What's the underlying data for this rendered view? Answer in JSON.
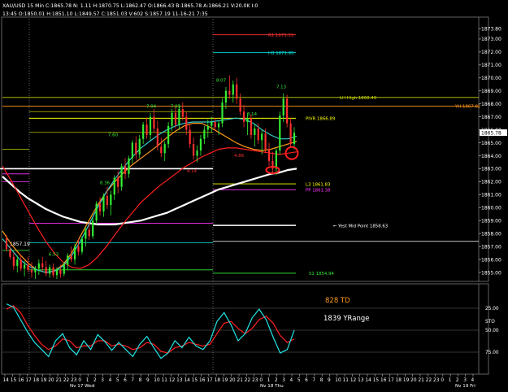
{
  "header": {
    "row1": "XAU/USD 15 Min C:1865.78  N:  1.11  H:1870.75  L:1862.47  O:1866.43  B:1865.78  A:1866.21  V:20.0K  I:0",
    "row2": "13:45  O:1850.01  H:1851.10  L:1849.57  C:1851.03  V:602  S:1857.19  11-16-21  7:35"
  },
  "chart_data": {
    "type": "line",
    "title": "XAU/USD 15 Min",
    "instrument": "XAU/USD",
    "timeframe": "15 Min",
    "quote": {
      "C": 1865.78,
      "N": 1.11,
      "H": 1870.75,
      "L": 1862.47,
      "O": 1866.43,
      "B": 1865.78,
      "A": 1866.21,
      "V": "20.0K",
      "I": 0
    },
    "cursor_bar": {
      "time": "13:45",
      "O": 1850.01,
      "H": 1851.1,
      "L": 1849.57,
      "C": 1851.03,
      "V": 602,
      "S": 1857.19,
      "date": "11-16-21",
      "clock": "7:35"
    },
    "price_ylim": [
      1854.5,
      1874.5
    ],
    "price_ticks": [
      1873.8,
      1873.0,
      1872.0,
      1871.0,
      1870.0,
      1869.0,
      1868.0,
      1867.0,
      1866.0,
      1865.0,
      1864.0,
      1863.0,
      1862.0,
      1861.0,
      1860.0,
      1859.0,
      1858.0,
      1857.0,
      1856.0,
      1855.0
    ],
    "tick_labels": [
      "1873.80",
      "1873.00",
      "1872.00",
      "1871.00",
      "1870.00",
      "1869.00",
      "1868.00",
      "1867.00",
      "1866.00",
      "1865.00",
      "1864.00",
      "1863.00",
      "1862.00",
      "1861.00",
      "1860.00",
      "1859.00",
      "1858.00",
      "1857.00",
      "1856.00",
      "1855.00"
    ],
    "last_price_label": "1865.78",
    "x_labels": [
      "14",
      "15",
      "16",
      "17",
      "18",
      "19",
      "20",
      "21",
      "22",
      "23",
      "0",
      "1",
      "2",
      "3",
      "4",
      "5",
      "6",
      "7",
      "8",
      "9",
      "10",
      "11",
      "12",
      "13",
      "14",
      "15",
      "16",
      "17",
      "18",
      "19",
      "20",
      "21",
      "22",
      "23",
      "0",
      "1",
      "2",
      "3",
      "4",
      "5",
      "6",
      "7",
      "8",
      "9",
      "10",
      "11",
      "12",
      "13",
      "14",
      "15",
      "16",
      "17",
      "18",
      "19",
      "20",
      "21",
      "22",
      "23",
      "0",
      "1",
      "2",
      "3",
      "4"
    ],
    "date_labels": [
      "Nv 17 Wed",
      "Nv 18 Thu",
      "Nv 19 Fri"
    ],
    "candles": [
      [
        1857.6,
        1857.9,
        1856.6,
        1856.8
      ],
      [
        1856.8,
        1857.0,
        1856.0,
        1856.2
      ],
      [
        1856.2,
        1856.5,
        1855.2,
        1855.5
      ],
      [
        1855.5,
        1856.3,
        1855.0,
        1856.0
      ],
      [
        1856.0,
        1856.4,
        1855.1,
        1855.3
      ],
      [
        1855.3,
        1855.9,
        1854.7,
        1855.6
      ],
      [
        1855.6,
        1856.2,
        1855.0,
        1855.2
      ],
      [
        1855.2,
        1855.8,
        1854.6,
        1855.0
      ],
      [
        1855.0,
        1855.5,
        1854.5,
        1855.3
      ],
      [
        1855.3,
        1856.0,
        1854.8,
        1855.7
      ],
      [
        1855.7,
        1856.2,
        1855.1,
        1855.4
      ],
      [
        1855.4,
        1855.9,
        1854.7,
        1854.9
      ],
      [
        1854.9,
        1855.6,
        1854.6,
        1855.4
      ],
      [
        1855.4,
        1855.7,
        1854.6,
        1854.8
      ],
      [
        1854.8,
        1855.4,
        1854.5,
        1855.2
      ],
      [
        1855.2,
        1855.6,
        1854.6,
        1854.9
      ],
      [
        1854.9,
        1855.8,
        1854.7,
        1855.6
      ],
      [
        1855.6,
        1856.5,
        1855.2,
        1856.3
      ],
      [
        1856.3,
        1857.0,
        1855.8,
        1856.0
      ],
      [
        1856.0,
        1857.2,
        1855.6,
        1857.0
      ],
      [
        1857.0,
        1857.6,
        1856.3,
        1856.6
      ],
      [
        1856.6,
        1857.8,
        1856.4,
        1857.6
      ],
      [
        1857.6,
        1858.5,
        1857.0,
        1858.3
      ],
      [
        1858.3,
        1858.9,
        1857.5,
        1857.8
      ],
      [
        1857.8,
        1859.2,
        1857.6,
        1859.0
      ],
      [
        1859.0,
        1860.5,
        1858.7,
        1860.3
      ],
      [
        1860.3,
        1860.8,
        1859.4,
        1859.7
      ],
      [
        1859.7,
        1861.1,
        1859.3,
        1860.9
      ],
      [
        1860.9,
        1861.6,
        1859.9,
        1860.2
      ],
      [
        1860.2,
        1861.3,
        1859.4,
        1861.0
      ],
      [
        1861.0,
        1862.5,
        1860.6,
        1862.3
      ],
      [
        1862.3,
        1862.8,
        1861.1,
        1861.6
      ],
      [
        1861.6,
        1863.4,
        1861.3,
        1863.2
      ],
      [
        1863.2,
        1863.8,
        1862.2,
        1862.6
      ],
      [
        1862.6,
        1864.0,
        1862.3,
        1863.8
      ],
      [
        1863.8,
        1865.2,
        1863.4,
        1865.0
      ],
      [
        1865.0,
        1865.5,
        1863.7,
        1864.1
      ],
      [
        1864.1,
        1865.6,
        1863.8,
        1865.3
      ],
      [
        1865.3,
        1866.6,
        1864.9,
        1866.4
      ],
      [
        1866.4,
        1866.9,
        1865.3,
        1865.6
      ],
      [
        1865.6,
        1867.3,
        1865.2,
        1867.0
      ],
      [
        1867.0,
        1867.6,
        1865.8,
        1866.1
      ],
      [
        1866.1,
        1866.7,
        1864.4,
        1864.7
      ],
      [
        1864.7,
        1865.4,
        1863.9,
        1864.2
      ],
      [
        1864.2,
        1865.1,
        1863.6,
        1864.9
      ],
      [
        1864.9,
        1866.6,
        1864.6,
        1866.3
      ],
      [
        1866.3,
        1867.6,
        1865.9,
        1867.3
      ],
      [
        1867.3,
        1867.8,
        1866.1,
        1866.4
      ],
      [
        1866.4,
        1867.9,
        1866.0,
        1867.6
      ],
      [
        1867.6,
        1868.1,
        1866.7,
        1867.0
      ],
      [
        1867.0,
        1867.4,
        1865.6,
        1866.0
      ],
      [
        1866.0,
        1866.5,
        1864.6,
        1864.9
      ],
      [
        1864.9,
        1865.4,
        1863.7,
        1864.0
      ],
      [
        1864.0,
        1864.8,
        1863.5,
        1864.4
      ],
      [
        1864.4,
        1865.6,
        1864.0,
        1865.3
      ],
      [
        1865.3,
        1866.3,
        1864.9,
        1866.0
      ],
      [
        1866.0,
        1866.8,
        1865.4,
        1866.3
      ],
      [
        1866.3,
        1867.0,
        1865.8,
        1866.6
      ],
      [
        1866.6,
        1866.9,
        1865.9,
        1866.2
      ],
      [
        1866.2,
        1866.7,
        1865.6,
        1866.5
      ],
      [
        1866.5,
        1868.4,
        1866.2,
        1868.1
      ],
      [
        1868.1,
        1869.3,
        1867.6,
        1869.0
      ],
      [
        1869.0,
        1870.2,
        1868.4,
        1868.7
      ],
      [
        1868.7,
        1869.8,
        1868.1,
        1869.5
      ],
      [
        1869.5,
        1870.0,
        1868.0,
        1868.4
      ],
      [
        1868.4,
        1868.8,
        1867.1,
        1867.4
      ],
      [
        1867.4,
        1867.9,
        1866.2,
        1866.6
      ],
      [
        1866.6,
        1867.3,
        1865.6,
        1866.9
      ],
      [
        1866.9,
        1867.2,
        1865.3,
        1865.6
      ],
      [
        1865.6,
        1866.4,
        1864.7,
        1866.1
      ],
      [
        1866.1,
        1866.5,
        1864.9,
        1865.2
      ],
      [
        1865.2,
        1866.0,
        1864.1,
        1865.7
      ],
      [
        1865.7,
        1866.1,
        1864.2,
        1864.5
      ],
      [
        1864.5,
        1865.0,
        1863.2,
        1863.6
      ],
      [
        1863.6,
        1864.3,
        1862.7,
        1863.0
      ],
      [
        1863.0,
        1864.6,
        1862.5,
        1864.4
      ],
      [
        1864.4,
        1867.4,
        1864.1,
        1867.1
      ],
      [
        1867.1,
        1868.8,
        1866.6,
        1868.4
      ],
      [
        1868.4,
        1868.7,
        1866.2,
        1866.5
      ],
      [
        1866.5,
        1866.9,
        1864.6,
        1864.9
      ],
      [
        1864.9,
        1866.2,
        1864.5,
        1865.78
      ]
    ],
    "moving_averages": [
      {
        "name": "white",
        "color": "#ffffff",
        "values": [
          1862.4,
          1861.8,
          1861.2,
          1860.7,
          1860.3,
          1859.9,
          1859.6,
          1859.3,
          1859.1,
          1858.9,
          1858.8,
          1858.7,
          1858.7,
          1858.7,
          1858.8,
          1858.9,
          1859.0,
          1859.2,
          1859.4,
          1859.6,
          1859.9,
          1860.2,
          1860.5,
          1860.8,
          1861.1,
          1861.4,
          1861.6,
          1861.8,
          1862.0,
          1862.2,
          1862.4,
          1862.6,
          1862.7,
          1862.9,
          1863.0
        ]
      },
      {
        "name": "red",
        "color": "#ff2020",
        "values": [
          1863.2,
          1862.1,
          1860.9,
          1859.7,
          1858.5,
          1857.4,
          1856.5,
          1855.8,
          1855.4,
          1855.3,
          1855.6,
          1856.2,
          1857.0,
          1857.9,
          1858.8,
          1859.6,
          1860.4,
          1861.0,
          1861.6,
          1862.1,
          1862.6,
          1863.1,
          1863.5,
          1863.9,
          1864.2,
          1864.5,
          1864.6,
          1864.6,
          1864.5,
          1864.4,
          1864.3,
          1864.2,
          1864.1,
          1864.2,
          1864.3
        ]
      },
      {
        "name": "orange",
        "color": "#ff9a1a",
        "values": [
          1858.2,
          1857.2,
          1856.4,
          1855.7,
          1855.2,
          1855.0,
          1855.1,
          1855.6,
          1856.5,
          1857.8,
          1859.0,
          1860.2,
          1861.2,
          1862.0,
          1862.7,
          1863.3,
          1863.8,
          1864.3,
          1864.8,
          1865.4,
          1865.9,
          1866.3,
          1866.5,
          1866.5,
          1866.2,
          1865.8,
          1865.4,
          1865.0,
          1864.7,
          1864.5,
          1864.4,
          1864.5,
          1864.7,
          1864.9,
          1865.1
        ]
      },
      {
        "name": "cyan",
        "color": "#33cccc",
        "values": [
          1857.6,
          1856.8,
          1856.0,
          1855.5,
          1855.2,
          1855.0,
          1855.1,
          1855.5,
          1856.3,
          1857.4,
          1858.7,
          1860.0,
          1861.2,
          1862.2,
          1863.1,
          1863.9,
          1864.6,
          1865.1,
          1865.6,
          1866.0,
          1866.3,
          1866.5,
          1866.6,
          1866.6,
          1866.6,
          1866.7,
          1866.8,
          1866.9,
          1866.8,
          1866.5,
          1866.0,
          1865.6,
          1865.3,
          1865.3,
          1865.5
        ]
      }
    ],
    "levels": [
      {
        "label": "R1 1873.33",
        "price": 1873.33,
        "color": "#ff3030"
      },
      {
        "label": "H3 1871.95",
        "price": 1871.95,
        "color": "#00e6e6"
      },
      {
        "label": "LH High 1868.49",
        "price": 1868.49,
        "color": "#c8d800"
      },
      {
        "label": "YH 1867.82",
        "price": 1867.82,
        "color": "#ff9a1a"
      },
      {
        "label": "PIVR 1866.89",
        "price": 1866.89,
        "color": "#ffff00"
      },
      {
        "label": "L3 1861.83",
        "price": 1861.83,
        "color": "#ffff00"
      },
      {
        "label": "PP 1861.38",
        "price": 1861.38,
        "color": "#ff33ff"
      },
      {
        "label": "Yest Mid Point 1858.63",
        "price": 1858.63,
        "color": "#ffffff"
      },
      {
        "label": "S1 1854.94",
        "price": 1854.94,
        "color": "#33ee33"
      }
    ],
    "swing_labels": [
      {
        "text": "6.53",
        "color": "#33ee33"
      },
      {
        "text": "8.36",
        "color": "#33ee33"
      },
      {
        "text": "7.60",
        "color": "#33ee33"
      },
      {
        "text": "7.04",
        "color": "#33ee33"
      },
      {
        "text": "7.05",
        "color": "#33ee33"
      },
      {
        "text": "4.14",
        "color": "#ff3030"
      },
      {
        "text": "8.07",
        "color": "#33ee33"
      },
      {
        "text": "3.14",
        "color": "#33ee33"
      },
      {
        "text": "4.86",
        "color": "#ff3030"
      },
      {
        "text": "7.13",
        "color": "#33ee33"
      }
    ],
    "left_label": "1857.19",
    "stochastic": {
      "label": "STO",
      "ylim": [
        0,
        100
      ],
      "tick_labels": [
        "25.00",
        "50.00",
        "75.00"
      ],
      "line1": {
        "name": "cyan",
        "color": "#22e6e6",
        "values": [
          20,
          24,
          38,
          52,
          64,
          72,
          80,
          62,
          54,
          70,
          78,
          62,
          72,
          55,
          63,
          73,
          64,
          72,
          80,
          66,
          57,
          70,
          82,
          76,
          62,
          70,
          58,
          68,
          72,
          62,
          40,
          30,
          44,
          62,
          54,
          36,
          26,
          38,
          58,
          76,
          72,
          50
        ]
      },
      "line2": {
        "name": "red",
        "color": "#ff2020",
        "values": [
          26,
          22,
          30,
          44,
          56,
          66,
          72,
          68,
          60,
          62,
          70,
          68,
          68,
          62,
          62,
          68,
          66,
          68,
          72,
          70,
          64,
          66,
          74,
          76,
          70,
          68,
          64,
          66,
          68,
          66,
          54,
          42,
          40,
          48,
          54,
          48,
          38,
          34,
          42,
          56,
          64,
          60
        ]
      }
    },
    "annotations": [
      {
        "text": "828 TD",
        "color": "#ff9a1a"
      },
      {
        "text": "1839 YRange",
        "color": "#ffffff"
      }
    ],
    "highlight_circles": 2
  }
}
